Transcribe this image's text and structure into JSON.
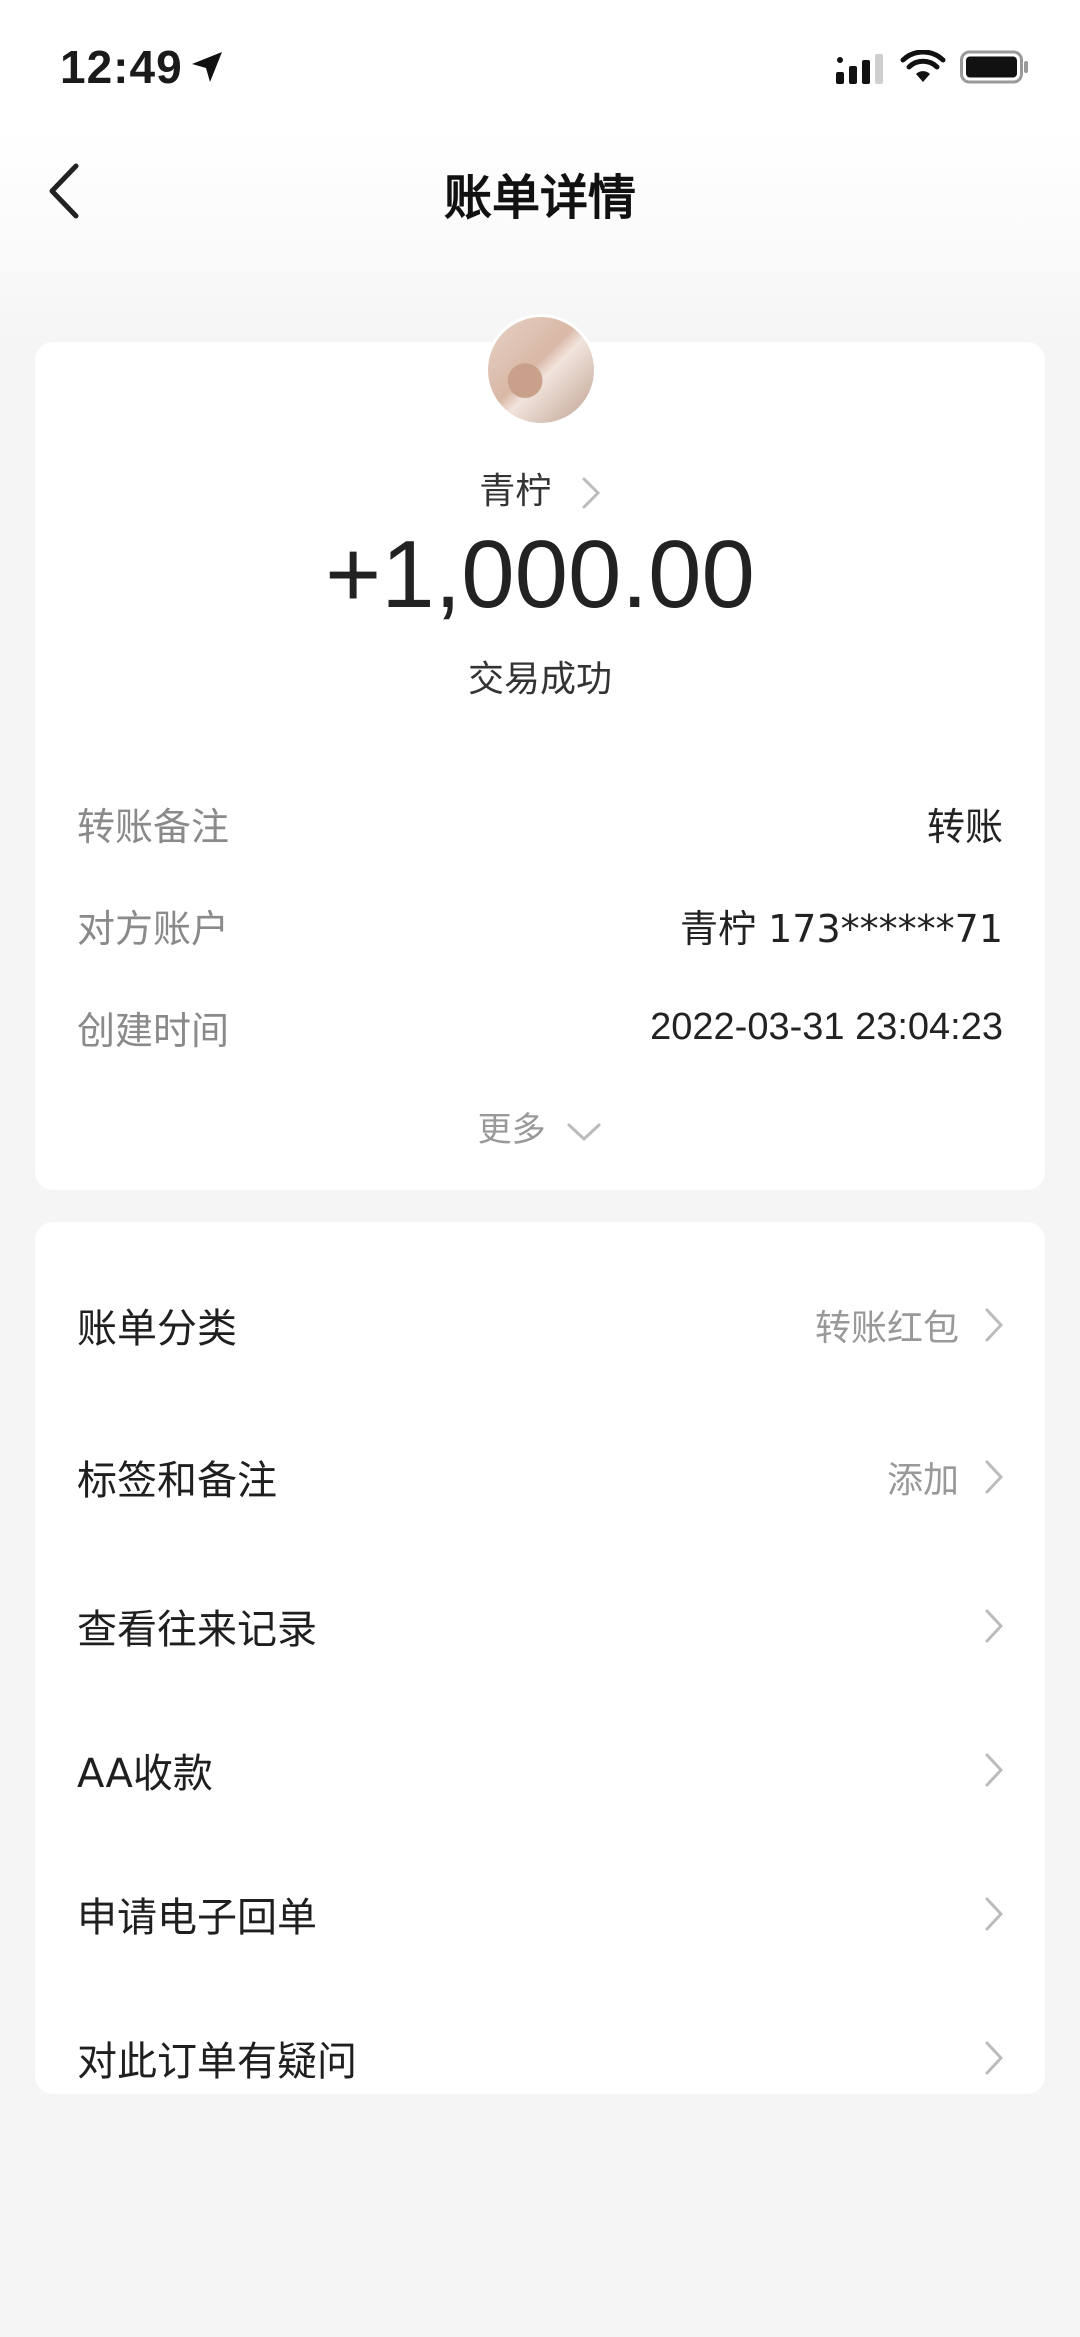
{
  "status_bar": {
    "time": "12:49"
  },
  "nav": {
    "title": "账单详情"
  },
  "summary": {
    "payee_name": "青柠",
    "amount": "+1,000.00",
    "status": "交易成功",
    "details": [
      {
        "label": "转账备注",
        "value": "转账"
      },
      {
        "label": "对方账户",
        "value": "青柠 173******71"
      },
      {
        "label": "创建时间",
        "value": "2022-03-31 23:04:23"
      }
    ],
    "more_label": "更多"
  },
  "actions": [
    {
      "label": "账单分类",
      "value": "转账红包"
    },
    {
      "label": "标签和备注",
      "value": "添加"
    },
    {
      "label": "查看往来记录",
      "value": ""
    },
    {
      "label": "AA收款",
      "value": ""
    },
    {
      "label": "申请电子回单",
      "value": ""
    },
    {
      "label": "对此订单有疑问",
      "value": ""
    }
  ]
}
